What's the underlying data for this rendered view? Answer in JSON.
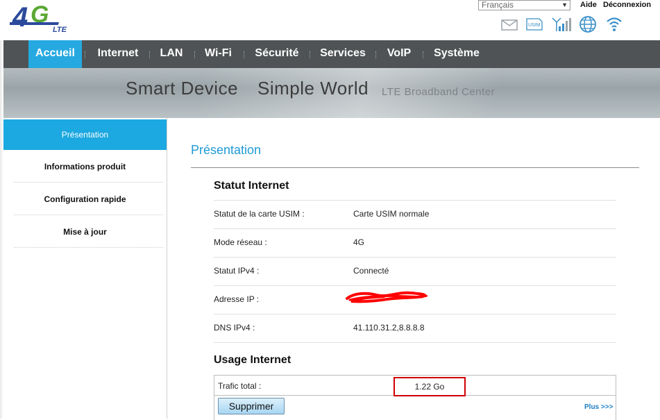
{
  "header": {
    "language": "Français",
    "help_label": "Aide",
    "logout_label": "Déconnexion",
    "logo_big": "4G",
    "logo_small": "LTE",
    "status_icons": [
      "mail-icon",
      "usim-icon",
      "signal-icon",
      "globe-icon",
      "wifi-icon"
    ],
    "usim_text": "USIM"
  },
  "nav": {
    "items": [
      "Accueil",
      "Internet",
      "LAN",
      "Wi-Fi",
      "Sécurité",
      "Services",
      "VoIP",
      "Système"
    ],
    "active": "Accueil"
  },
  "banner": {
    "slogan_1": "Smart Device",
    "slogan_2": "Simple World",
    "slogan_3": "LTE Broadband Center"
  },
  "sidebar": {
    "items": [
      "Présentation",
      "Informations produit",
      "Configuration rapide",
      "Mise à jour"
    ],
    "active": "Présentation"
  },
  "main": {
    "title": "Présentation",
    "internet_status": {
      "title": "Statut Internet",
      "rows": [
        {
          "label": "Statut de la carte USIM :",
          "value": "Carte USIM normale"
        },
        {
          "label": "Mode réseau :",
          "value": "4G"
        },
        {
          "label": "Statut IPv4 :",
          "value": "Connecté"
        },
        {
          "label": "Adresse IP :",
          "value": ""
        },
        {
          "label": "DNS IPv4 :",
          "value": "41.110.31.2,8.8.8.8"
        }
      ]
    },
    "internet_usage": {
      "title": "Usage Internet",
      "traffic_label": "Trafic total :",
      "traffic_value": "1.22 Go",
      "delete_button": "Supprimer",
      "more_link": "Plus >>>"
    }
  },
  "colors": {
    "accent": "#25a9e0",
    "nav_bg": "#4f5355",
    "title_blue": "#1f9ad6",
    "highlight_red": "#d00000",
    "redaction_red": "#ff0000"
  }
}
